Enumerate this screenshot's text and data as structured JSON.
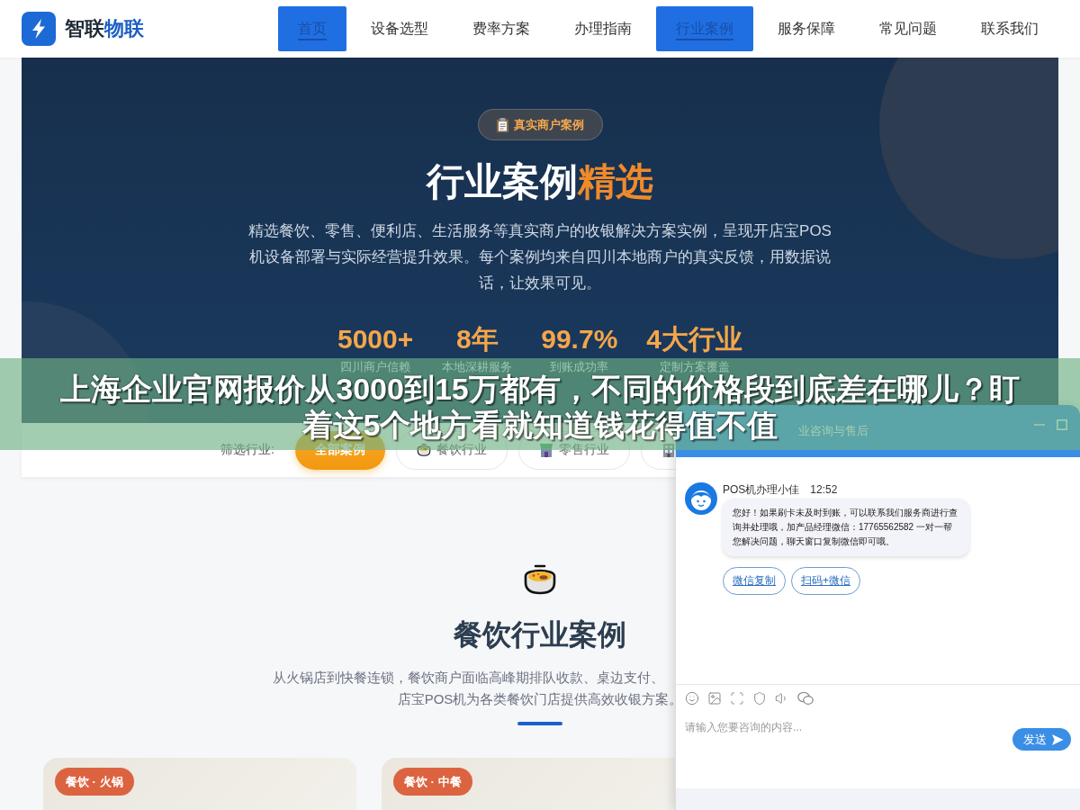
{
  "header": {
    "logo": {
      "name": "智联",
      "accent": "物联"
    },
    "nav": [
      {
        "label": "首页",
        "selected": true
      },
      {
        "label": "设备选型",
        "selected": false
      },
      {
        "label": "费率方案",
        "selected": false
      },
      {
        "label": "办理指南",
        "selected": false
      },
      {
        "label": "行业案例",
        "selected": true
      },
      {
        "label": "服务保障",
        "selected": false
      },
      {
        "label": "常见问题",
        "selected": false
      },
      {
        "label": "联系我们",
        "selected": false
      }
    ]
  },
  "hero": {
    "badge": "真实商户案例",
    "title": {
      "main": "行业案例",
      "accent": "精选"
    },
    "description": "精选餐饮、零售、便利店、生活服务等真实商户的收银解决方案实例，呈现开店宝POS机设备部署与实际经营提升效果。每个案例均来自四川本地商户的真实反馈，用数据说话，让效果可见。",
    "stats": [
      {
        "value": "5000+",
        "label": "四川商户信赖"
      },
      {
        "value": "8年",
        "label": "本地深耕服务"
      },
      {
        "value": "99.7%",
        "label": "到账成功率"
      },
      {
        "value": "4大行业",
        "label": "定制方案覆盖"
      }
    ]
  },
  "filter": {
    "label": "筛选行业:",
    "options": [
      {
        "label": "全部案例",
        "selected": true
      },
      {
        "label": "餐饮行业",
        "selected": false
      },
      {
        "label": "零售行业",
        "selected": false
      },
      {
        "selected": false
      }
    ]
  },
  "section": {
    "title": "餐饮行业案例",
    "description_lines": [
      "从火锅店到快餐连锁，餐饮商户面临高峰期排队收款、桌边支付、",
      "店宝POS机为各类餐饮门店提供高效收银方案。"
    ]
  },
  "cards": [
    {
      "tag": "餐饮 · 火锅"
    },
    {
      "tag": "餐饮 · 中餐"
    }
  ],
  "chat": {
    "title": "业咨询与售后",
    "agent": {
      "name": "POS机办理小佳",
      "time": "12:52"
    },
    "message": "您好！如果刷卡未及时到账，可以联系我们服务商进行查询并处理哦，加产品经理微信：17765562582 一对一帮您解决问题，聊天窗口复制微信即可哦。",
    "quick_replies": [
      "微信复制",
      "扫码+微信"
    ],
    "input": {
      "placeholder": "请输入您要咨询的内容..."
    },
    "send_button": "发送"
  },
  "overlay_caption": {
    "lines": [
      "上海企业官网报价从3000到15万都有，不同的价格段到底差在哪儿？盯",
      "着这5个地方看就知道钱花得值不值"
    ]
  }
}
